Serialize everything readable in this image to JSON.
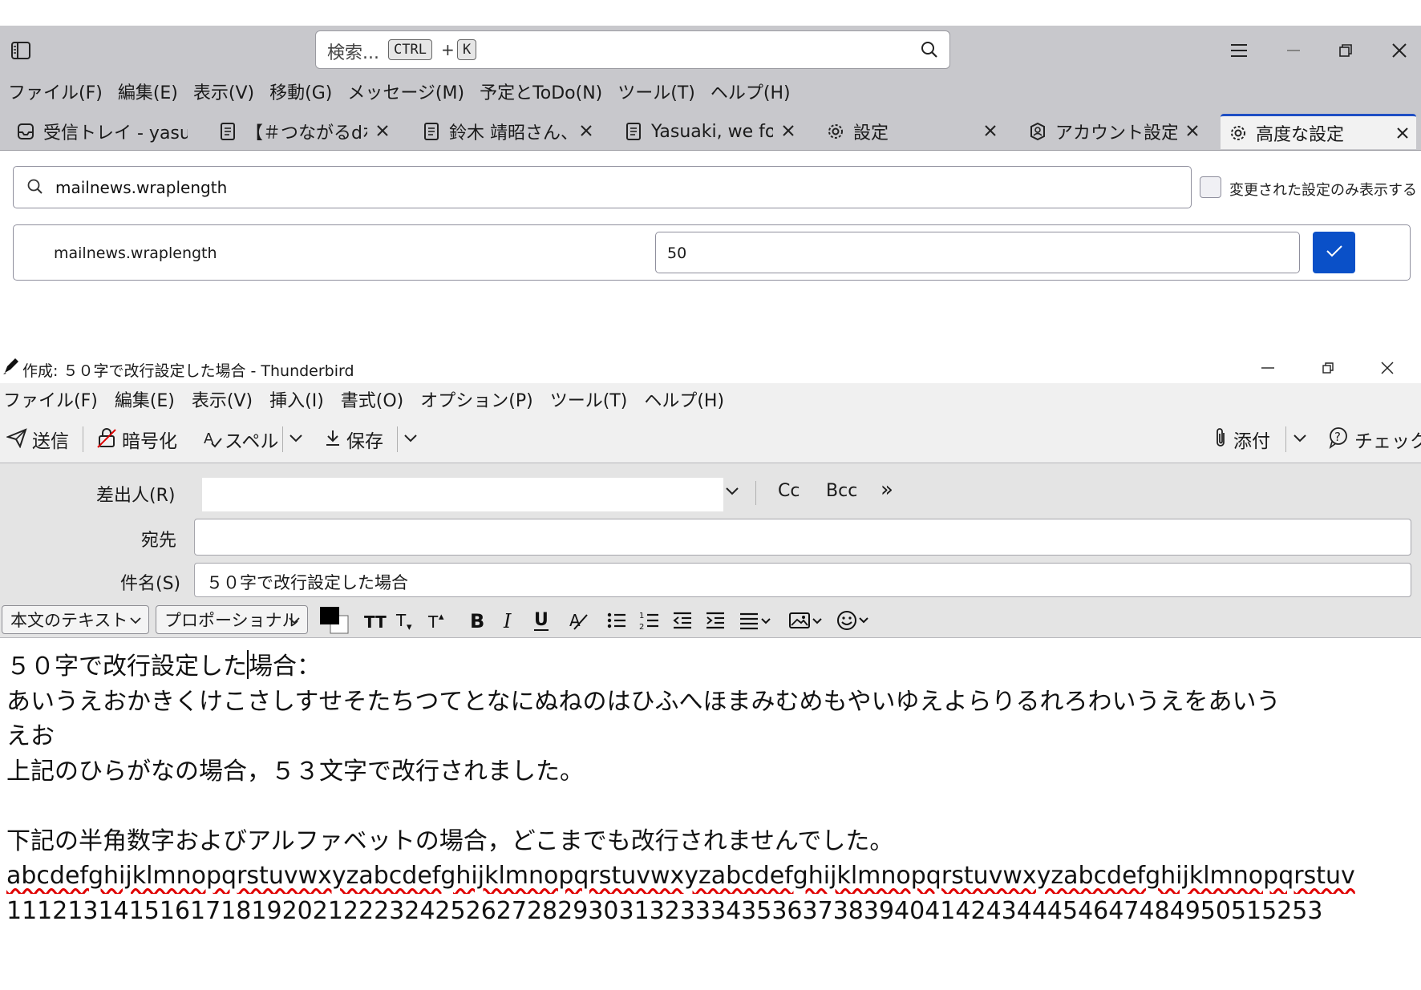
{
  "main_window": {
    "search": {
      "placeholder": "検索...",
      "key1": "CTRL",
      "plus": "+",
      "key2": "K"
    },
    "menu": [
      "ファイル(F)",
      "編集(E)",
      "表示(V)",
      "移動(G)",
      "メッセージ(M)",
      "予定とToDo(N)",
      "ツール(T)",
      "ヘルプ(H)"
    ],
    "tabs": [
      {
        "title": "受信トレイ - yasuz",
        "icon": "inbox-icon",
        "closable": false
      },
      {
        "title": "【＃つながるdポ",
        "icon": "message-icon",
        "closable": true
      },
      {
        "title": "鈴木 靖昭さん、",
        "icon": "message-icon",
        "closable": true
      },
      {
        "title": "Yasuaki, we fo",
        "icon": "message-icon",
        "closable": true
      },
      {
        "title": "設定",
        "icon": "gear-icon",
        "closable": true
      },
      {
        "title": "アカウント設定",
        "icon": "account-icon",
        "closable": true
      },
      {
        "title": "高度な設定",
        "icon": "gear-icon",
        "closable": true,
        "active": true
      }
    ],
    "config_editor": {
      "search_value": "mailnews.wraplength",
      "show_modified_label": "変更された設定のみ表示する",
      "pref_name": "mailnews.wraplength",
      "pref_value": "50"
    }
  },
  "compose": {
    "title": "作成: ５０字で改行設定した場合 - Thunderbird",
    "menu": [
      "ファイル(F)",
      "編集(E)",
      "表示(V)",
      "挿入(I)",
      "書式(O)",
      "オプション(P)",
      "ツール(T)",
      "ヘルプ(H)"
    ],
    "toolbar": {
      "send": "送信",
      "encrypt": "暗号化",
      "spell": "スペル",
      "save": "保存",
      "attach": "添付",
      "check": "チェック"
    },
    "headers": {
      "from_label": "差出人(R)",
      "from_value": "",
      "cc": "Cc",
      "bcc": "Bcc",
      "more": "»",
      "to_label": "宛先",
      "to_value": "",
      "subject_label": "件名(S)",
      "subject_value": "５０字で改行設定した場合"
    },
    "format": {
      "paragraph": "本文のテキスト",
      "font": "プロポーショナル",
      "text_color": "#000000",
      "background_color": "#ffffff"
    },
    "body": {
      "line1_a": "５０字で改行設定した",
      "line1_b": "場合：",
      "line2": "あいうえおかきくけこさしすせそたちつてとなにぬねのはひふへほまみむめもやいゆえよらりるれろわいうえをあいう",
      "line3": "えお",
      "line4": "上記のひらがなの場合，５３文字で改行されました。",
      "line5": "",
      "line6": "下記の半角数字およびアルファベットの場合，どこまでも改行されませんでした。",
      "line7": "abcdefghijklmnopqrstuvwxyzabcdefghijklmnopqrstuvwxyzabcdefghijklmnopqrstuvwxyzabcdefghijklmnopqrstuv",
      "line8": "11121314151617181920212223242526272829303132333435363738394041424344454647484950515253"
    }
  }
}
